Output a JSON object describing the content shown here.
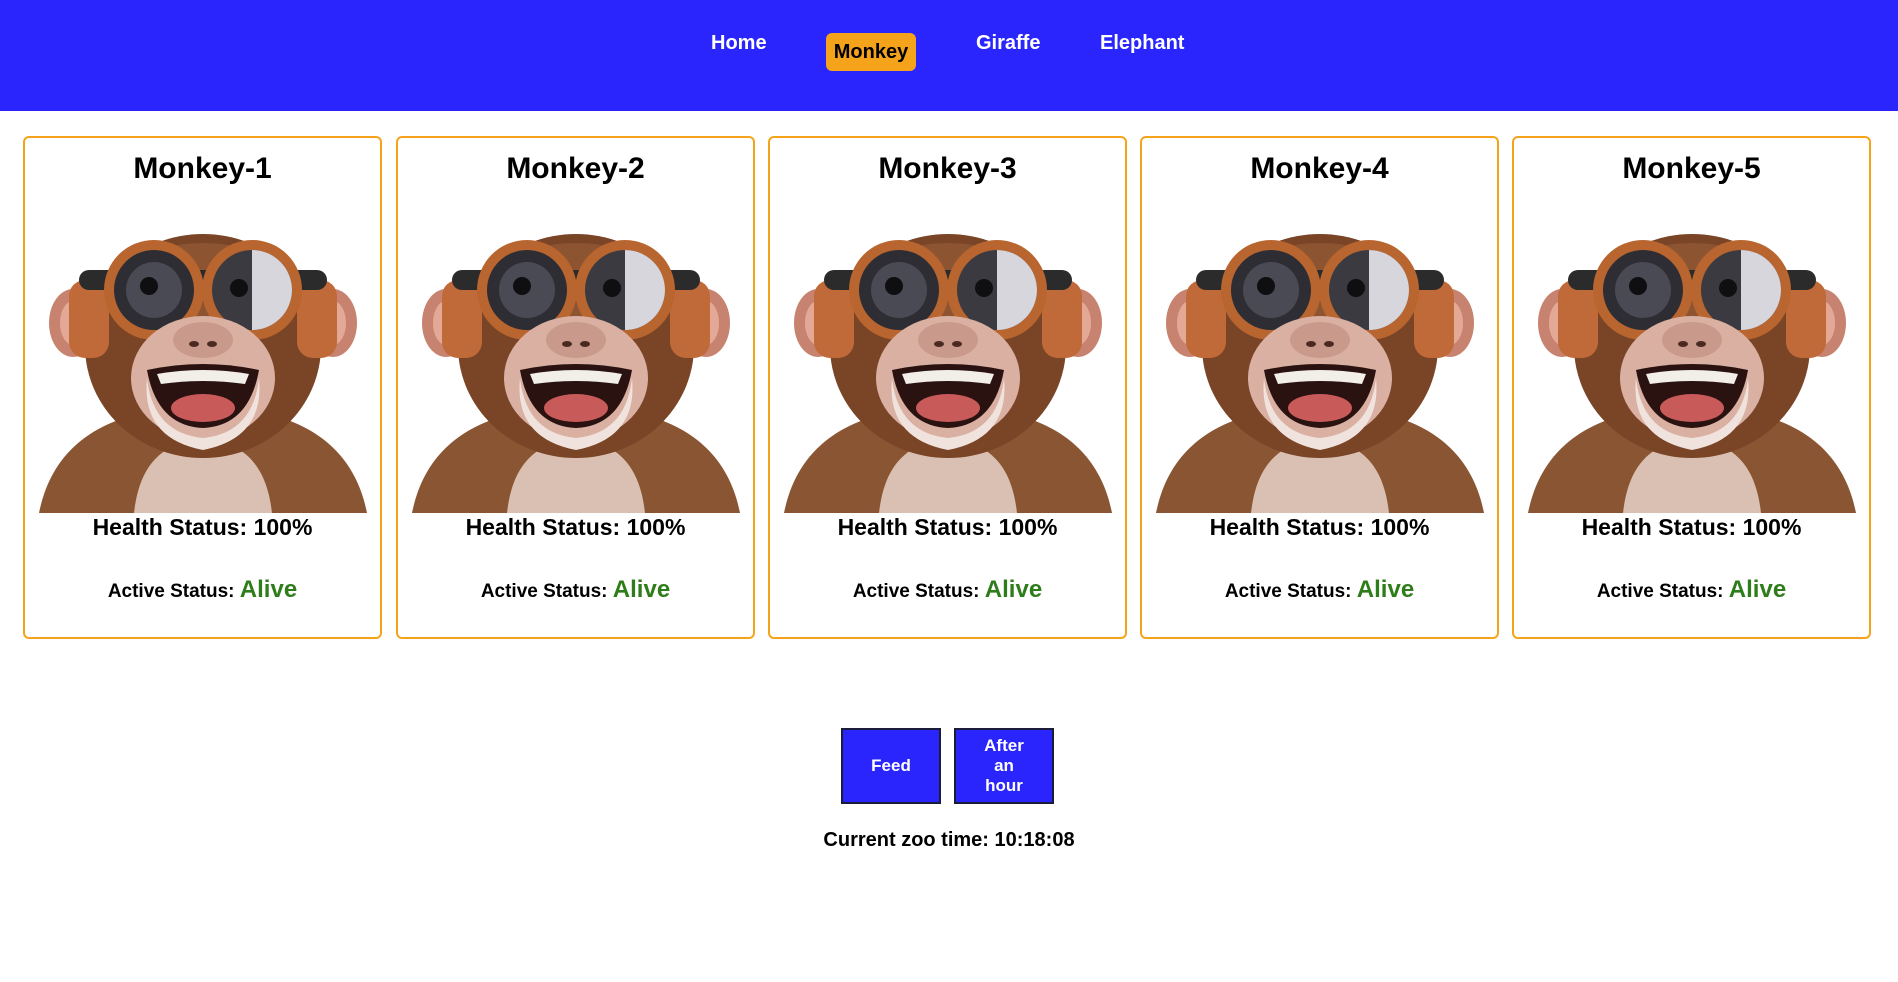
{
  "nav": {
    "items": [
      {
        "label": "Home"
      },
      {
        "label": "Monkey"
      },
      {
        "label": "Giraffe"
      },
      {
        "label": "Elephant"
      }
    ],
    "active_index": 1
  },
  "animals": [
    {
      "name": "Monkey-1",
      "health_label": "Health Status: 100%",
      "active_label": "Active Status:",
      "active_value": "Alive"
    },
    {
      "name": "Monkey-2",
      "health_label": "Health Status: 100%",
      "active_label": "Active Status:",
      "active_value": "Alive"
    },
    {
      "name": "Monkey-3",
      "health_label": "Health Status: 100%",
      "active_label": "Active Status:",
      "active_value": "Alive"
    },
    {
      "name": "Monkey-4",
      "health_label": "Health Status: 100%",
      "active_label": "Active Status:",
      "active_value": "Alive"
    },
    {
      "name": "Monkey-5",
      "health_label": "Health Status: 100%",
      "active_label": "Active Status:",
      "active_value": "Alive"
    }
  ],
  "controls": {
    "feed_label": "Feed",
    "hour_label": "After an hour"
  },
  "zoo_time": "Current zoo time: 10:18:08",
  "colors": {
    "header": "#2a24fd",
    "accent": "#f6a31c",
    "alive": "#2e7d1a"
  }
}
